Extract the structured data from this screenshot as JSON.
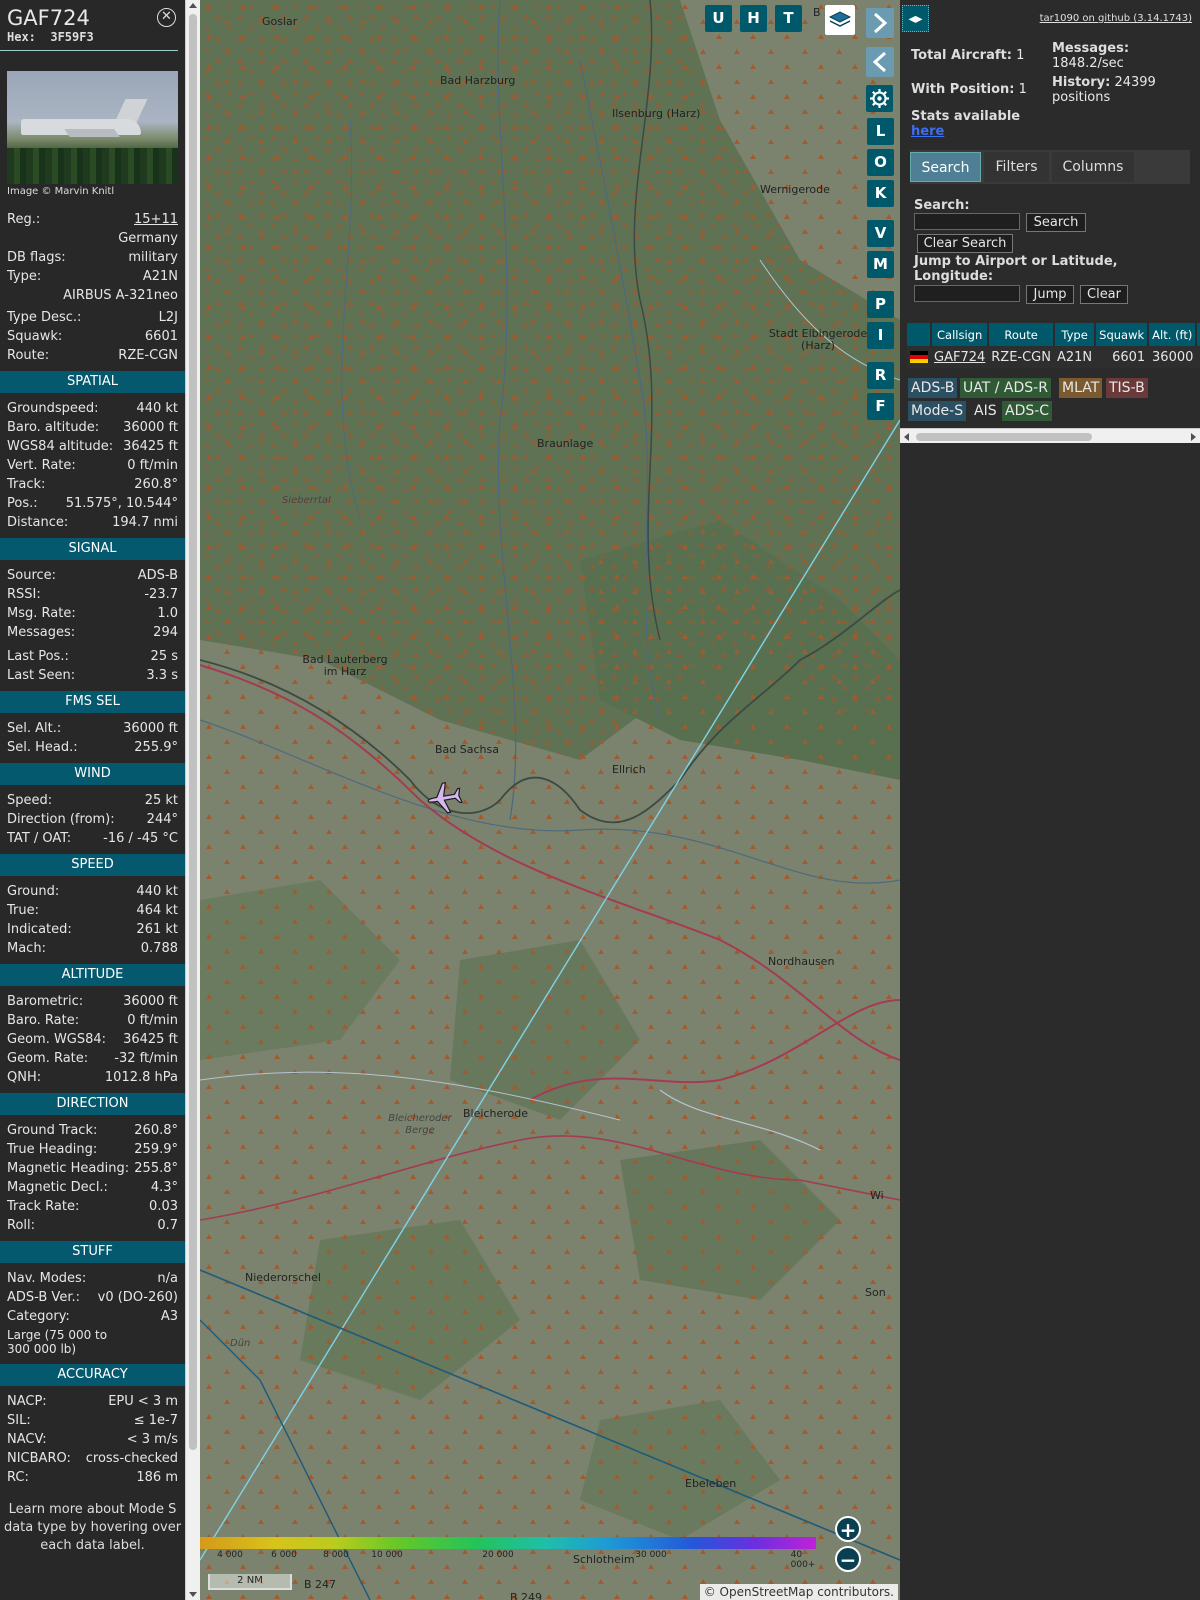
{
  "detail": {
    "callsign": "GAF724",
    "hex_label": "Hex:",
    "hex": "3F59F3",
    "close_icon": "close-icon",
    "image_credit": "Image © Marvin Knitl",
    "rows1": [
      {
        "label": "Reg.:",
        "value": "15+11",
        "link": true
      },
      {
        "label": "",
        "value": "Germany"
      },
      {
        "label": "DB flags:",
        "value": "military"
      },
      {
        "label": "Type:",
        "value": "A21N"
      },
      {
        "label": "",
        "value": "AIRBUS A-321neo"
      }
    ],
    "rows2": [
      {
        "label": "Type Desc.:",
        "value": "L2J"
      },
      {
        "label": "Squawk:",
        "value": "6601"
      },
      {
        "label": "Route:",
        "value": "RZE-CGN"
      }
    ],
    "sections": [
      {
        "title": "SPATIAL",
        "rows": [
          {
            "label": "Groundspeed:",
            "value": "440 kt"
          },
          {
            "label": "Baro. altitude:",
            "value": "36000 ft"
          },
          {
            "label": "WGS84 altitude:",
            "value": "36425 ft"
          },
          {
            "label": "Vert. Rate:",
            "value": "0 ft/min"
          },
          {
            "label": "Track:",
            "value": "260.8°"
          },
          {
            "label": "Pos.:",
            "value": "51.575°, 10.544°"
          },
          {
            "label": "Distance:",
            "value": "194.7 nmi"
          }
        ]
      },
      {
        "title": "SIGNAL",
        "rows": [
          {
            "label": "Source:",
            "value": "ADS-B"
          },
          {
            "label": "RSSI:",
            "value": "-23.7"
          },
          {
            "label": "Msg. Rate:",
            "value": "1.0"
          },
          {
            "label": "Messages:",
            "value": "294"
          }
        ],
        "rows_b": [
          {
            "label": "Last Pos.:",
            "value": "25 s"
          },
          {
            "label": "Last Seen:",
            "value": "3.3 s"
          }
        ]
      },
      {
        "title": "FMS SEL",
        "rows": [
          {
            "label": "Sel. Alt.:",
            "value": "36000 ft"
          },
          {
            "label": "Sel. Head.:",
            "value": "255.9°"
          }
        ]
      },
      {
        "title": "WIND",
        "rows": [
          {
            "label": "Speed:",
            "value": "25 kt"
          },
          {
            "label": "Direction (from):",
            "value": "244°"
          },
          {
            "label": "TAT / OAT:",
            "value": "-16 / -45 °C"
          }
        ]
      },
      {
        "title": "SPEED",
        "rows": [
          {
            "label": "Ground:",
            "value": "440 kt"
          },
          {
            "label": "True:",
            "value": "464 kt"
          },
          {
            "label": "Indicated:",
            "value": "261 kt"
          },
          {
            "label": "Mach:",
            "value": "0.788"
          }
        ]
      },
      {
        "title": "ALTITUDE",
        "rows": [
          {
            "label": "Barometric:",
            "value": "36000 ft"
          },
          {
            "label": "Baro. Rate:",
            "value": "0 ft/min"
          },
          {
            "label": "Geom. WGS84:",
            "value": "36425 ft"
          },
          {
            "label": "Geom. Rate:",
            "value": "-32 ft/min"
          },
          {
            "label": "QNH:",
            "value": "1012.8 hPa"
          }
        ]
      },
      {
        "title": "DIRECTION",
        "rows": [
          {
            "label": "Ground Track:",
            "value": "260.8°"
          },
          {
            "label": "True Heading:",
            "value": "259.9°"
          },
          {
            "label": "Magnetic Heading:",
            "value": "255.8°"
          },
          {
            "label": "Magnetic Decl.:",
            "value": "4.3°"
          },
          {
            "label": "Track Rate:",
            "value": "0.03"
          },
          {
            "label": "Roll:",
            "value": "0.7"
          }
        ]
      },
      {
        "title": "STUFF",
        "rows": [
          {
            "label": "Nav. Modes:",
            "value": "n/a"
          },
          {
            "label": "ADS-B Ver.:",
            "value": "v0 (DO-260)"
          },
          {
            "label": "Category:",
            "value": "A3"
          }
        ],
        "note": "Large (75 000 to 300 000 lb)"
      },
      {
        "title": "ACCURACY",
        "rows": [
          {
            "label": "NACP:",
            "value": "EPU < 3 m"
          },
          {
            "label": "SIL:",
            "value": "≤ 1e-7"
          },
          {
            "label": "NACV:",
            "value": "< 3 m/s"
          },
          {
            "label": "NICBARO:",
            "value": "cross-checked"
          },
          {
            "label": "RC:",
            "value": "186 m"
          }
        ]
      }
    ],
    "learn_more": "Learn more about Mode S data type by hovering over each data label."
  },
  "map": {
    "labels": [
      {
        "text": "Goslar"
      },
      {
        "text": "Bad Harzburg"
      },
      {
        "text": "Ilsenburg (Harz)"
      },
      {
        "text": "Wernigerode"
      },
      {
        "text": "Stadt Elbingerode (Harz)"
      },
      {
        "text": "Braunlage"
      },
      {
        "text": "Sieberrtal"
      },
      {
        "text": "Bad Lauterberg im Harz"
      },
      {
        "text": "Bad Sachsa"
      },
      {
        "text": "Ellrich"
      },
      {
        "text": "Nordhausen"
      },
      {
        "text": "Bleicheroder Berge"
      },
      {
        "text": "Bleicherode"
      },
      {
        "text": "Niederorschel"
      },
      {
        "text": "Dün"
      },
      {
        "text": "Ebeleben"
      },
      {
        "text": "Schlotheim"
      },
      {
        "text": "B 247"
      },
      {
        "text": "B 249"
      },
      {
        "text": "B 244"
      },
      {
        "text": "Son"
      },
      {
        "text": "Wi"
      }
    ],
    "top_buttons": [
      "U",
      "H",
      "T"
    ],
    "side_buttons": [
      "L",
      "O",
      "K",
      "V",
      "M",
      "P",
      "I",
      "R",
      "F"
    ],
    "icons": {
      "layers": "layers-icon",
      "forward": "chevron-right-icon",
      "back": "chevron-left-icon",
      "settings": "gear-icon",
      "zoom_in": "plus-icon",
      "zoom_out": "minus-icon",
      "aircraft": "aircraft-icon"
    },
    "alt_ticks": [
      "4 000",
      "6 000",
      "8 000",
      "10 000",
      "20 000",
      "30 000",
      "40 000+"
    ],
    "scale": "2 NM",
    "attribution_prefix": "© ",
    "attribution_link": "OpenStreetMap",
    "attribution_suffix": " contributors."
  },
  "sidebar": {
    "toggle": "◂▸",
    "github": "tar1090 on github (3.14.1743)",
    "total_aircraft_label": "Total Aircraft:",
    "total_aircraft": "1",
    "with_position_label": "With Position:",
    "with_position": "1",
    "messages_label": "Messages:",
    "messages": "1848.2/sec",
    "history_label": "History:",
    "history": "24399 positions",
    "stats_label": "Stats available",
    "stats_link": "here",
    "tabs": [
      "Search",
      "Filters",
      "Columns"
    ],
    "search_label": "Search:",
    "search_btn": "Search",
    "clear_search_btn": "Clear Search",
    "jump_label": "Jump to Airport or Latitude, Longitude:",
    "jump_btn": "Jump",
    "clear_btn": "Clear",
    "table": {
      "headers": [
        "",
        "Callsign",
        "Route",
        "Type",
        "Squawk",
        "Alt. (ft)",
        "S"
      ],
      "row": {
        "callsign": "GAF724",
        "route": "RZE-CGN",
        "type": "A21N",
        "squawk": "6601",
        "alt": "36000",
        "flag_icon": "germany-flag-icon"
      }
    },
    "legend": [
      {
        "text": "ADS-B",
        "bg": "#2b4f63",
        "color": "#e8e8e8"
      },
      {
        "text": "UAT / ADS-R",
        "bg": "#2f5a35",
        "color": "#e8e8e8"
      },
      {
        "text": "MLAT",
        "bg": "#7a5a2e",
        "color": "#e8e8e8"
      },
      {
        "text": "TIS-B",
        "bg": "#6a3a3a",
        "color": "#e8e8e8"
      },
      {
        "text": "Mode-S",
        "bg": "#2b4f63",
        "color": "#e8e8e8"
      },
      {
        "text": "AIS",
        "bg": "transparent",
        "color": "#e8e8e8"
      },
      {
        "text": "ADS-C",
        "bg": "#2f5a35",
        "color": "#e8e8e8"
      }
    ]
  }
}
